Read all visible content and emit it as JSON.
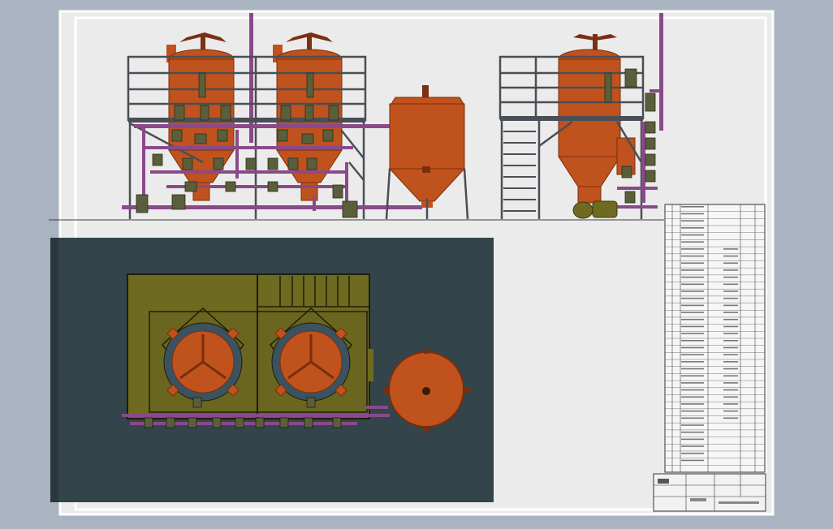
{
  "colors": {
    "background": "#a9b3c2",
    "sheet": "#ebebeb",
    "frame": "#ffffff",
    "tank": "#c0521d",
    "tank_dark": "#7a2e0c",
    "pipe": "#8a4a8a",
    "frame_steel": "#4a4e55",
    "olive": "#6e6a1f",
    "olive_dark": "#3e3b10",
    "plan_bg": "#33444a",
    "valve": "#5a5e3a"
  },
  "views": {
    "elevation": {
      "tanks": [
        {
          "kind": "filter-tank-1"
        },
        {
          "kind": "filter-tank-2"
        },
        {
          "kind": "open-mixing-tank"
        },
        {
          "kind": "filter-tank-3"
        }
      ]
    },
    "plan": {
      "tanks": [
        {
          "kind": "filter-tank-1-top"
        },
        {
          "kind": "filter-tank-2-top"
        },
        {
          "kind": "round-tank-top"
        }
      ]
    }
  },
  "parts_list": {
    "row_count": 38
  }
}
